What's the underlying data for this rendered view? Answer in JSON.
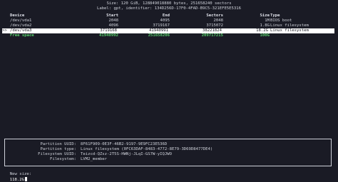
{
  "header": {
    "line1": "Size: 120 GiB, 128849018880 bytes, 251658240 sectors",
    "line2": "Label: gpt, identifier: 134D256D-17F0-4FAD-B9C5-321EFE5E5316"
  },
  "columns": {
    "device": "Device",
    "start": "Start",
    "end": "End",
    "sectors": "Sectors",
    "size": "Size",
    "type": "Type"
  },
  "rows": [
    {
      "device": "/dev/vda1",
      "start": "2048",
      "end": "4095",
      "sectors": "2048",
      "size": "1M",
      "type": "BIOS boot"
    },
    {
      "device": "/dev/vda2",
      "start": "4096",
      "end": "3719167",
      "sectors": "3715072",
      "size": "1.8G",
      "type": "Linux filesystem"
    },
    {
      "device": "/dev/vda3",
      "start": "3719168",
      "end": "41940991",
      "sectors": "38221824",
      "size": "18.2G",
      "type": "Linux filesystem"
    },
    {
      "device": "Free space",
      "start": "41940992",
      "end": "251658206",
      "sectors": "209717215",
      "size": "100G",
      "type": ""
    }
  ],
  "selected_marker": ">>",
  "info": [
    {
      "key": "Partition UUID:",
      "value": "8F61F909-0E3F-46B2-9197-9E9FC23E536D"
    },
    {
      "key": "Partition type:",
      "value": "Linux filesystem (0FC63DAF-8483-4772-8E79-3D69D8477DE4)"
    },
    {
      "key": "Filesystem UUID:",
      "value": "Teizcd-QZsz-2T5S-HWNj-JLqI-GS7W-yIQJWO"
    },
    {
      "key": "Filesystem:",
      "value": "LVM2_member"
    }
  ],
  "prompt": {
    "label": "New size:",
    "value": "118.2G"
  },
  "colors": {
    "background": "#1a1b25",
    "selection": "#ffffff",
    "free_space": "#59d36e"
  }
}
